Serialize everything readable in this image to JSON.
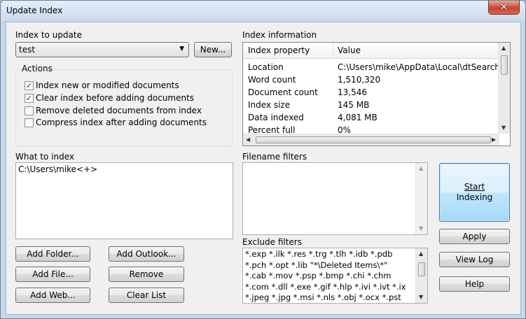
{
  "window": {
    "title": "Update Index",
    "close_glyph": "✕"
  },
  "index_to_update": {
    "label": "Index to update",
    "selected": "test",
    "new_button": "New..."
  },
  "actions": {
    "legend": "Actions",
    "items": [
      {
        "label": "Index new or modified documents",
        "checked": true
      },
      {
        "label": "Clear index before adding documents",
        "checked": true
      },
      {
        "label": "Remove deleted documents from index",
        "checked": false
      },
      {
        "label": "Compress index after adding documents",
        "checked": false
      }
    ]
  },
  "index_information": {
    "label": "Index information",
    "columns": [
      "Index property",
      "Value"
    ],
    "rows": [
      {
        "property": "Location",
        "value": "C:\\Users\\mike\\AppData\\Local\\dtSearch\\te"
      },
      {
        "property": "Word count",
        "value": "1,510,320"
      },
      {
        "property": "Document count",
        "value": "13,546"
      },
      {
        "property": "Index size",
        "value": "145 MB"
      },
      {
        "property": "Data indexed",
        "value": "4,081 MB"
      },
      {
        "property": "Percent full",
        "value": "0%"
      }
    ]
  },
  "what_to_index": {
    "label": "What to index",
    "value": "C:\\Users\\mike<+>"
  },
  "filename_filters": {
    "label": "Filename filters",
    "value": ""
  },
  "exclude_filters": {
    "label": "Exclude filters",
    "lines": [
      "*.exp *.ilk *.res *.trg *.tlh *.idb *.pdb",
      "*.pch *.opt *.lib \"*\\Deleted Items\\*\"",
      "*.cab *.mov *.psp *.bmp *.chi *.chm",
      "*.com *.dll *.exe *.gif *.hlp *.ivi *.ivt *.ix",
      "*.jpeg *.jpg *.msi *.nls *.obj *.ocx *.pst"
    ]
  },
  "buttons": {
    "add_folder": "Add Folder...",
    "add_outlook": "Add Outlook...",
    "add_file": "Add File...",
    "remove": "Remove",
    "add_web": "Add Web...",
    "clear_list": "Clear List",
    "start_line1": "Start",
    "start_line2": "Indexing",
    "apply": "Apply",
    "view_log": "View Log",
    "help": "Help"
  },
  "icons": {
    "dropdown": "chevron-down-icon",
    "check": "checkmark-icon",
    "scroll_up": "arrow-up-icon",
    "scroll_down": "arrow-down-icon",
    "scroll_left": "arrow-left-icon",
    "scroll_right": "arrow-right-icon"
  }
}
